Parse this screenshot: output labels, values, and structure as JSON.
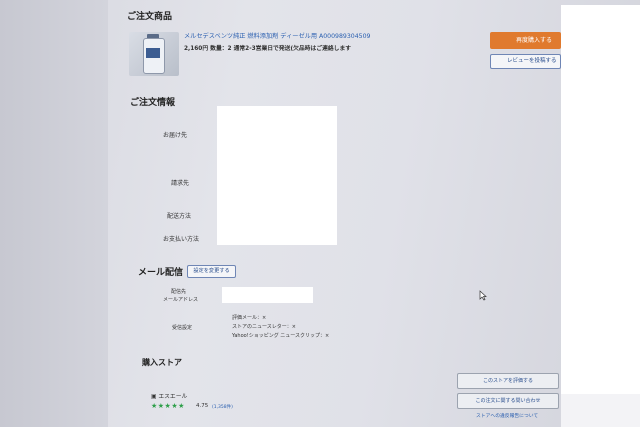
{
  "order_items": {
    "title": "ご注文商品",
    "product_name": "メルセデスベンツ純正 燃料添加剤 ディーゼル用 A000989304509",
    "price_qty": "2,160円  数量：2  通常2-3営業日で発送(欠品時はご連絡します",
    "rebuy_label": "再度購入する",
    "review_label": "レビューを投稿する"
  },
  "order_info": {
    "title": "ご注文情報",
    "delivery_label": "お届け先",
    "billing_label": "請求先",
    "shipping_method_label": "配送方法",
    "payment_label": "お支払い方法"
  },
  "mail": {
    "title": "メール配信",
    "settings_button": "設定を変更する",
    "recipient_label_1": "配信先",
    "recipient_label_2": "メールアドレス",
    "receive_label": "受信設定",
    "receive_lines": [
      "評価メール：×",
      "ストアのニュースレター：×",
      "Yahoo!ショッピング ニュースクリップ：×"
    ]
  },
  "store": {
    "title": "購入ストア",
    "name": "エスエール",
    "rating": "4.75",
    "review_count": "(1,358件)",
    "rating_fraction": 0.95,
    "rate_store_button": "このストアを評価する",
    "contact_button": "この注文に関する問い合わせ",
    "report_link": "ストアへの違反報告について"
  },
  "colors": {
    "accent_orange": "#e07a2e",
    "link_blue": "#2a5fb0",
    "star_green": "#2e9f4a"
  }
}
